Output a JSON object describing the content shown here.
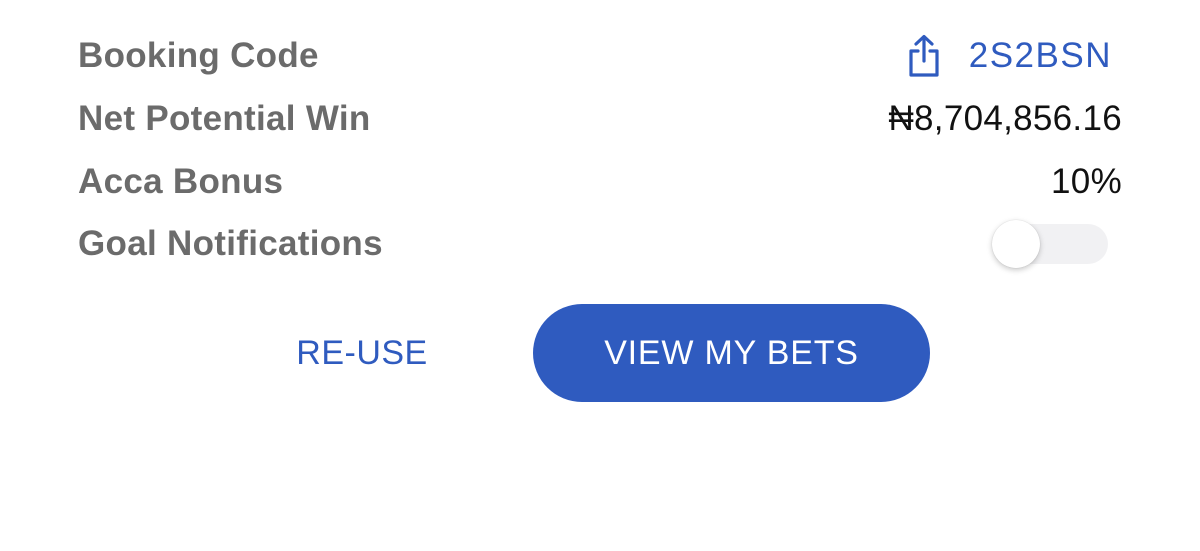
{
  "rows": {
    "booking": {
      "label": "Booking Code",
      "code": "2S2BSN",
      "icon": "share-icon"
    },
    "net_win": {
      "label": "Net Potential Win",
      "value": "₦8,704,856.16"
    },
    "acca": {
      "label": "Acca Bonus",
      "value": "10%"
    },
    "goal": {
      "label": "Goal Notifications",
      "toggle_on": false
    }
  },
  "buttons": {
    "reuse": "RE-USE",
    "view_bets": "VIEW MY BETS"
  },
  "colors": {
    "accent": "#2f5bbf",
    "label": "#6b6b6b",
    "value": "#111111",
    "toggle_track": "#f1f1f3"
  }
}
